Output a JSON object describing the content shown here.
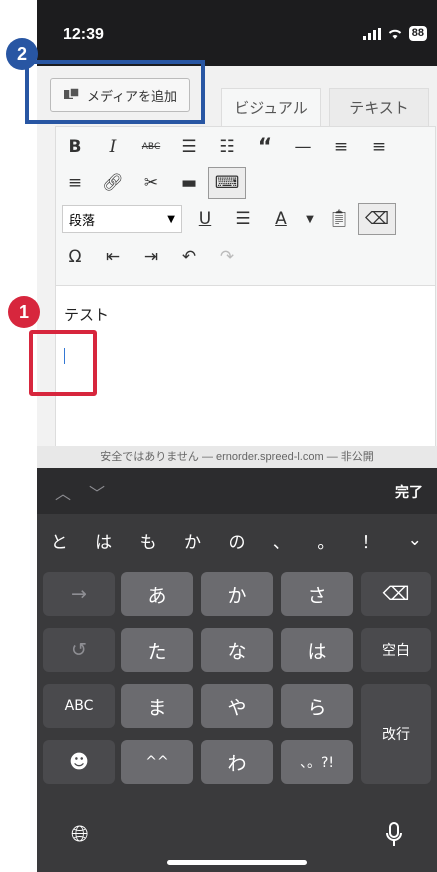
{
  "status": {
    "time": "12:39",
    "battery": "88",
    "signal_icon": "signal-icon",
    "wifi_icon": "wifi-icon"
  },
  "editor": {
    "add_media_label": "メディアを追加",
    "tab_visual": "ビジュアル",
    "tab_text": "テキスト",
    "format_select": "段落",
    "content_text": "テスト"
  },
  "url_bar": "安全ではありません — ernorder.spreed-l.com — 非公開",
  "keyboard": {
    "done_label": "完了",
    "candidates": [
      "と",
      "は",
      "も",
      "か",
      "の",
      "、",
      "。",
      "！"
    ],
    "row1": [
      "あ",
      "か",
      "さ"
    ],
    "row2": [
      "た",
      "な",
      "は"
    ],
    "row3": [
      "ま",
      "や",
      "ら"
    ],
    "row4": [
      "^^",
      "わ",
      "、。?!"
    ],
    "abc_label": "ABC",
    "space_label": "空白",
    "enter_label": "改行"
  },
  "annotations": {
    "marker_1": "1",
    "marker_2": "2",
    "color_red": "#d7263d",
    "color_blue": "#2856a3"
  }
}
